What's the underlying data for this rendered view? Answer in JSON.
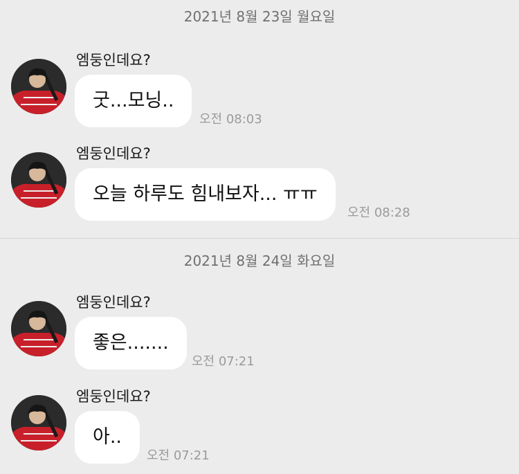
{
  "dates": [
    {
      "label": "2021년 8월 23일 월요일"
    },
    {
      "label": "2021년 8월 24일 화요일"
    }
  ],
  "messages": [
    {
      "sender": "엠둥인데요?",
      "text": "굿...모닝..",
      "time": "오전 08:03"
    },
    {
      "sender": "엠둥인데요?",
      "text": "오늘 하루도 힘내보자... ㅠㅠ",
      "time": "오전 08:28"
    },
    {
      "sender": "엠둥인데요?",
      "text": "좋은.......",
      "time": "오전 07:21"
    },
    {
      "sender": "엠둥인데요?",
      "text": "아..",
      "time": "오전 07:21"
    }
  ],
  "colors": {
    "background": "#ececec",
    "bubble": "#ffffff",
    "timestamp": "#9a9a9a",
    "date_header": "#707070",
    "avatar_jacket": "#c8202a"
  }
}
